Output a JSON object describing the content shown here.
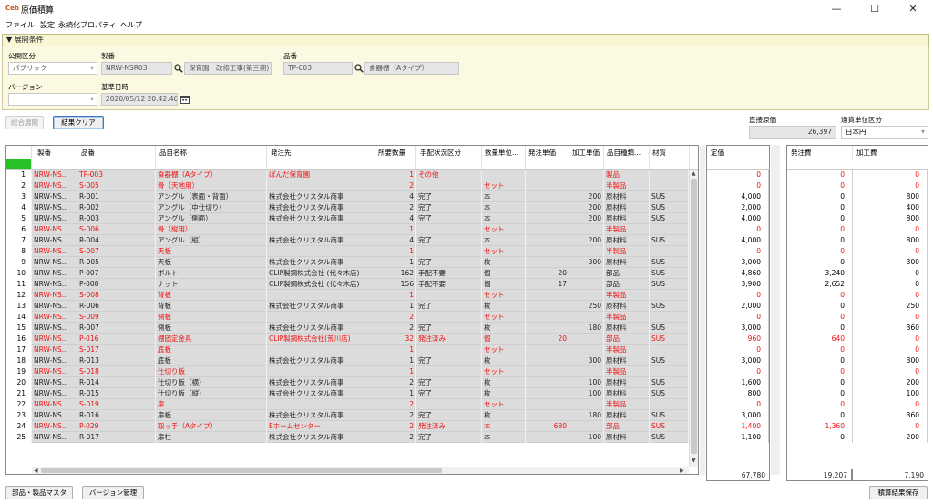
{
  "window": {
    "app_icon": "Ceb",
    "title": "原価積算",
    "minimize": "—",
    "maximize": "☐",
    "close": "✕"
  },
  "menu": [
    "ファイル",
    "設定",
    "永続化プロパティ",
    "ヘルプ"
  ],
  "panel": {
    "title": "▼ 展開条件"
  },
  "filters": {
    "publish_label": "公開区分",
    "publish_value": "パブリック",
    "version_label": "バージョン",
    "version_value": "",
    "seiban_label": "製番",
    "seiban_value": "NRW-NSR03",
    "seiban_name": "保育園　改修工事(第三期)",
    "hinban_label": "品番",
    "hinban_value": "TP-003",
    "hinban_name": "食器棚（Aタイプ）",
    "date_label": "基準日時",
    "date_value": "2020/05/12 20:42:46"
  },
  "buttons": {
    "expand": "総合展開",
    "clear": "結果クリア",
    "parts_master": "部品・製品マスタ",
    "version_mgmt": "バージョン管理",
    "save": "積算結果保存"
  },
  "summary": {
    "direct_cost_label": "直接原価",
    "direct_cost_value": "26,397",
    "currency_label": "通貨単位区分",
    "currency_value": "日本円"
  },
  "columns": [
    "",
    "製番",
    "品番",
    "品目名称",
    "発注先",
    "所要数量",
    "手配状況区分",
    "数量単位...",
    "発注単価",
    "加工単価",
    "品目種類...",
    "材質"
  ],
  "right_columns": {
    "list_price": "定価",
    "order_cost": "発注費",
    "processing_cost": "加工費"
  },
  "rows": [
    {
      "no": "1",
      "seiban": "NRW-NS...",
      "hinban": "TP-003",
      "name": "食器棚（Aタイプ）",
      "supplier": "ぱんだ保育園",
      "qty": "1",
      "status": "その他",
      "unit": "",
      "order_price": "",
      "proc_price": "",
      "kind": "製品",
      "material": "",
      "red": true,
      "list": "0",
      "order": "0",
      "proc": "0"
    },
    {
      "no": "2",
      "seiban": "NRW-NS...",
      "hinban": "S-005",
      "name": "骨（天地用）",
      "supplier": "",
      "qty": "2",
      "status": "",
      "unit": "セット",
      "order_price": "",
      "proc_price": "",
      "kind": "半製品",
      "material": "",
      "red": true,
      "list": "0",
      "order": "0",
      "proc": "0"
    },
    {
      "no": "3",
      "seiban": "NRW-NS...",
      "hinban": "R-001",
      "name": "アングル（表面・背面）",
      "supplier": "株式会社クリスタル商事",
      "qty": "4",
      "status": "完了",
      "unit": "本",
      "order_price": "",
      "proc_price": "200",
      "kind": "原材料",
      "material": "SUS",
      "red": false,
      "list": "4,000",
      "order": "0",
      "proc": "800"
    },
    {
      "no": "4",
      "seiban": "NRW-NS...",
      "hinban": "R-002",
      "name": "アングル（中仕切り）",
      "supplier": "株式会社クリスタル商事",
      "qty": "2",
      "status": "完了",
      "unit": "本",
      "order_price": "",
      "proc_price": "200",
      "kind": "原材料",
      "material": "SUS",
      "red": false,
      "list": "2,000",
      "order": "0",
      "proc": "400"
    },
    {
      "no": "5",
      "seiban": "NRW-NS...",
      "hinban": "R-003",
      "name": "アングル（側面）",
      "supplier": "株式会社クリスタル商事",
      "qty": "4",
      "status": "完了",
      "unit": "本",
      "order_price": "",
      "proc_price": "200",
      "kind": "原材料",
      "material": "SUS",
      "red": false,
      "list": "4,000",
      "order": "0",
      "proc": "800"
    },
    {
      "no": "6",
      "seiban": "NRW-NS...",
      "hinban": "S-006",
      "name": "骨（縦用）",
      "supplier": "",
      "qty": "1",
      "status": "",
      "unit": "セット",
      "order_price": "",
      "proc_price": "",
      "kind": "半製品",
      "material": "",
      "red": true,
      "list": "0",
      "order": "0",
      "proc": "0"
    },
    {
      "no": "7",
      "seiban": "NRW-NS...",
      "hinban": "R-004",
      "name": "アングル（縦）",
      "supplier": "株式会社クリスタル商事",
      "qty": "4",
      "status": "完了",
      "unit": "本",
      "order_price": "",
      "proc_price": "200",
      "kind": "原材料",
      "material": "SUS",
      "red": false,
      "list": "4,000",
      "order": "0",
      "proc": "800"
    },
    {
      "no": "8",
      "seiban": "NRW-NS...",
      "hinban": "S-007",
      "name": "天板",
      "supplier": "",
      "qty": "1",
      "status": "",
      "unit": "セット",
      "order_price": "",
      "proc_price": "",
      "kind": "半製品",
      "material": "",
      "red": true,
      "list": "0",
      "order": "0",
      "proc": "0"
    },
    {
      "no": "9",
      "seiban": "NRW-NS...",
      "hinban": "R-005",
      "name": "天板",
      "supplier": "株式会社クリスタル商事",
      "qty": "1",
      "status": "完了",
      "unit": "枚",
      "order_price": "",
      "proc_price": "300",
      "kind": "原材料",
      "material": "SUS",
      "red": false,
      "list": "3,000",
      "order": "0",
      "proc": "300"
    },
    {
      "no": "10",
      "seiban": "NRW-NS...",
      "hinban": "P-007",
      "name": "ボルト",
      "supplier": "CLIP製鋼株式会社 (代々木店)",
      "qty": "162",
      "status": "手配不要",
      "unit": "個",
      "order_price": "20",
      "proc_price": "",
      "kind": "部品",
      "material": "SUS",
      "red": false,
      "list": "4,860",
      "order": "3,240",
      "proc": "0"
    },
    {
      "no": "11",
      "seiban": "NRW-NS...",
      "hinban": "P-008",
      "name": "ナット",
      "supplier": "CLIP製鋼株式会社 (代々木店)",
      "qty": "156",
      "status": "手配不要",
      "unit": "個",
      "order_price": "17",
      "proc_price": "",
      "kind": "部品",
      "material": "SUS",
      "red": false,
      "list": "3,900",
      "order": "2,652",
      "proc": "0"
    },
    {
      "no": "12",
      "seiban": "NRW-NS...",
      "hinban": "S-008",
      "name": "背板",
      "supplier": "",
      "qty": "1",
      "status": "",
      "unit": "セット",
      "order_price": "",
      "proc_price": "",
      "kind": "半製品",
      "material": "",
      "red": true,
      "list": "0",
      "order": "0",
      "proc": "0"
    },
    {
      "no": "13",
      "seiban": "NRW-NS...",
      "hinban": "R-006",
      "name": "背板",
      "supplier": "株式会社クリスタル商事",
      "qty": "1",
      "status": "完了",
      "unit": "枚",
      "order_price": "",
      "proc_price": "250",
      "kind": "原材料",
      "material": "SUS",
      "red": false,
      "list": "2,000",
      "order": "0",
      "proc": "250"
    },
    {
      "no": "14",
      "seiban": "NRW-NS...",
      "hinban": "S-009",
      "name": "側板",
      "supplier": "",
      "qty": "2",
      "status": "",
      "unit": "セット",
      "order_price": "",
      "proc_price": "",
      "kind": "半製品",
      "material": "",
      "red": true,
      "list": "0",
      "order": "0",
      "proc": "0"
    },
    {
      "no": "15",
      "seiban": "NRW-NS...",
      "hinban": "R-007",
      "name": "側板",
      "supplier": "株式会社クリスタル商事",
      "qty": "2",
      "status": "完了",
      "unit": "枚",
      "order_price": "",
      "proc_price": "180",
      "kind": "原材料",
      "material": "SUS",
      "red": false,
      "list": "3,000",
      "order": "0",
      "proc": "360"
    },
    {
      "no": "16",
      "seiban": "NRW-NS...",
      "hinban": "P-016",
      "name": "棚固定金具",
      "supplier": "CLIP製鋼株式会社(荒川店)",
      "qty": "32",
      "status": "発注済み",
      "unit": "個",
      "order_price": "20",
      "proc_price": "",
      "kind": "部品",
      "material": "SUS",
      "red": true,
      "list": "960",
      "order": "640",
      "proc": "0"
    },
    {
      "no": "17",
      "seiban": "NRW-NS...",
      "hinban": "S-017",
      "name": "底板",
      "supplier": "",
      "qty": "1",
      "status": "",
      "unit": "セット",
      "order_price": "",
      "proc_price": "",
      "kind": "半製品",
      "material": "",
      "red": true,
      "list": "0",
      "order": "0",
      "proc": "0"
    },
    {
      "no": "18",
      "seiban": "NRW-NS...",
      "hinban": "R-013",
      "name": "底板",
      "supplier": "株式会社クリスタル商事",
      "qty": "1",
      "status": "完了",
      "unit": "枚",
      "order_price": "",
      "proc_price": "300",
      "kind": "原材料",
      "material": "SUS",
      "red": false,
      "list": "3,000",
      "order": "0",
      "proc": "300"
    },
    {
      "no": "19",
      "seiban": "NRW-NS...",
      "hinban": "S-018",
      "name": "仕切り板",
      "supplier": "",
      "qty": "1",
      "status": "",
      "unit": "セット",
      "order_price": "",
      "proc_price": "",
      "kind": "半製品",
      "material": "",
      "red": true,
      "list": "0",
      "order": "0",
      "proc": "0"
    },
    {
      "no": "20",
      "seiban": "NRW-NS...",
      "hinban": "R-014",
      "name": "仕切り板（横）",
      "supplier": "株式会社クリスタル商事",
      "qty": "2",
      "status": "完了",
      "unit": "枚",
      "order_price": "",
      "proc_price": "100",
      "kind": "原材料",
      "material": "SUS",
      "red": false,
      "list": "1,600",
      "order": "0",
      "proc": "200"
    },
    {
      "no": "21",
      "seiban": "NRW-NS...",
      "hinban": "R-015",
      "name": "仕切り板（縦）",
      "supplier": "株式会社クリスタル商事",
      "qty": "1",
      "status": "完了",
      "unit": "枚",
      "order_price": "",
      "proc_price": "100",
      "kind": "原材料",
      "material": "SUS",
      "red": false,
      "list": "800",
      "order": "0",
      "proc": "100"
    },
    {
      "no": "22",
      "seiban": "NRW-NS...",
      "hinban": "S-019",
      "name": "扉",
      "supplier": "",
      "qty": "2",
      "status": "",
      "unit": "セット",
      "order_price": "",
      "proc_price": "",
      "kind": "半製品",
      "material": "",
      "red": true,
      "list": "0",
      "order": "0",
      "proc": "0"
    },
    {
      "no": "23",
      "seiban": "NRW-NS...",
      "hinban": "R-016",
      "name": "扉板",
      "supplier": "株式会社クリスタル商事",
      "qty": "2",
      "status": "完了",
      "unit": "枚",
      "order_price": "",
      "proc_price": "180",
      "kind": "原材料",
      "material": "SUS",
      "red": false,
      "list": "3,000",
      "order": "0",
      "proc": "360"
    },
    {
      "no": "24",
      "seiban": "NRW-NS...",
      "hinban": "P-029",
      "name": "取っ手（Aタイプ）",
      "supplier": "Eホームセンター",
      "qty": "2",
      "status": "発注済み",
      "unit": "本",
      "order_price": "680",
      "proc_price": "",
      "kind": "部品",
      "material": "SUS",
      "red": true,
      "list": "1,400",
      "order": "1,360",
      "proc": "0"
    },
    {
      "no": "25",
      "seiban": "NRW-NS...",
      "hinban": "R-017",
      "name": "扉柱",
      "supplier": "株式会社クリスタル商事",
      "qty": "2",
      "status": "完了",
      "unit": "本",
      "order_price": "",
      "proc_price": "100",
      "kind": "原材料",
      "material": "SUS",
      "red": false,
      "list": "1,100",
      "order": "0",
      "proc": "200"
    }
  ],
  "totals": {
    "list": "67,780",
    "order": "19,207",
    "proc": "7,190"
  },
  "colors": {
    "red_row": "#ee1111",
    "row_bg": "#dcdcdc",
    "panel_bg": "#fbf9e2",
    "accent": "#c8531b"
  }
}
